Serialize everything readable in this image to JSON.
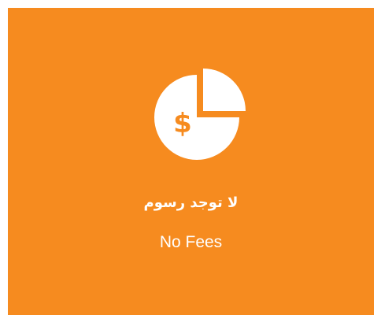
{
  "tile": {
    "background_color": "#F68B1F",
    "icon": "pie-chart-dollar-icon",
    "title_ar": "لا توجد رسوم",
    "title_en": "No Fees"
  }
}
